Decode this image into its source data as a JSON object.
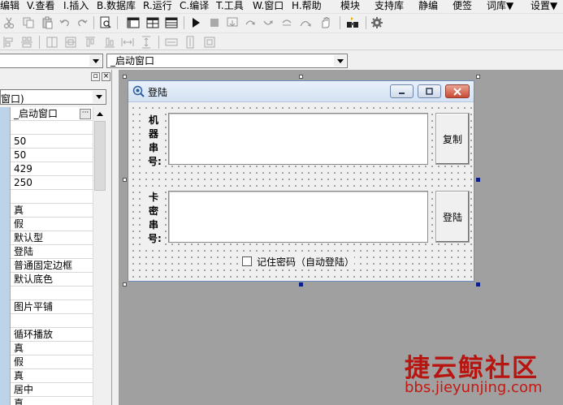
{
  "menu": [
    "编辑",
    "V.查看",
    "I.插入",
    "B.数据库",
    "R.运行",
    "C.编译",
    "T.工具",
    "W.窗口",
    "H.帮助",
    "模块",
    "支持库",
    "静编",
    "便签",
    "词库▼",
    "设置▼"
  ],
  "combos": {
    "left_value": "",
    "right_value": "_启动窗口"
  },
  "panel": {
    "object_combo": "窗口)",
    "rows": [
      {
        "value": "_启动窗口",
        "selected": true
      },
      {
        "value": ""
      },
      {
        "value": "50"
      },
      {
        "value": "50"
      },
      {
        "value": "429"
      },
      {
        "value": "250"
      },
      {
        "value": ""
      },
      {
        "value": "真"
      },
      {
        "value": "假"
      },
      {
        "value": "默认型"
      },
      {
        "value": "登陆"
      },
      {
        "value": "普通固定边框"
      },
      {
        "value": "默认底色"
      },
      {
        "value": ""
      },
      {
        "value": "图片平铺"
      },
      {
        "value": ""
      },
      {
        "value": "循环播放"
      },
      {
        "value": "真"
      },
      {
        "value": "假"
      },
      {
        "value": "真"
      },
      {
        "value": "居中"
      },
      {
        "value": "真"
      }
    ]
  },
  "form": {
    "title": "登陆",
    "label_machine": "机器串号:",
    "label_card": "卡密串号:",
    "copy_button": "复制",
    "login_button": "登陆",
    "remember_label": "记住密码（自动登陆）"
  },
  "watermark": {
    "line1": "捷云鲸社区",
    "line2": "bbs.jieyunjing.com"
  }
}
